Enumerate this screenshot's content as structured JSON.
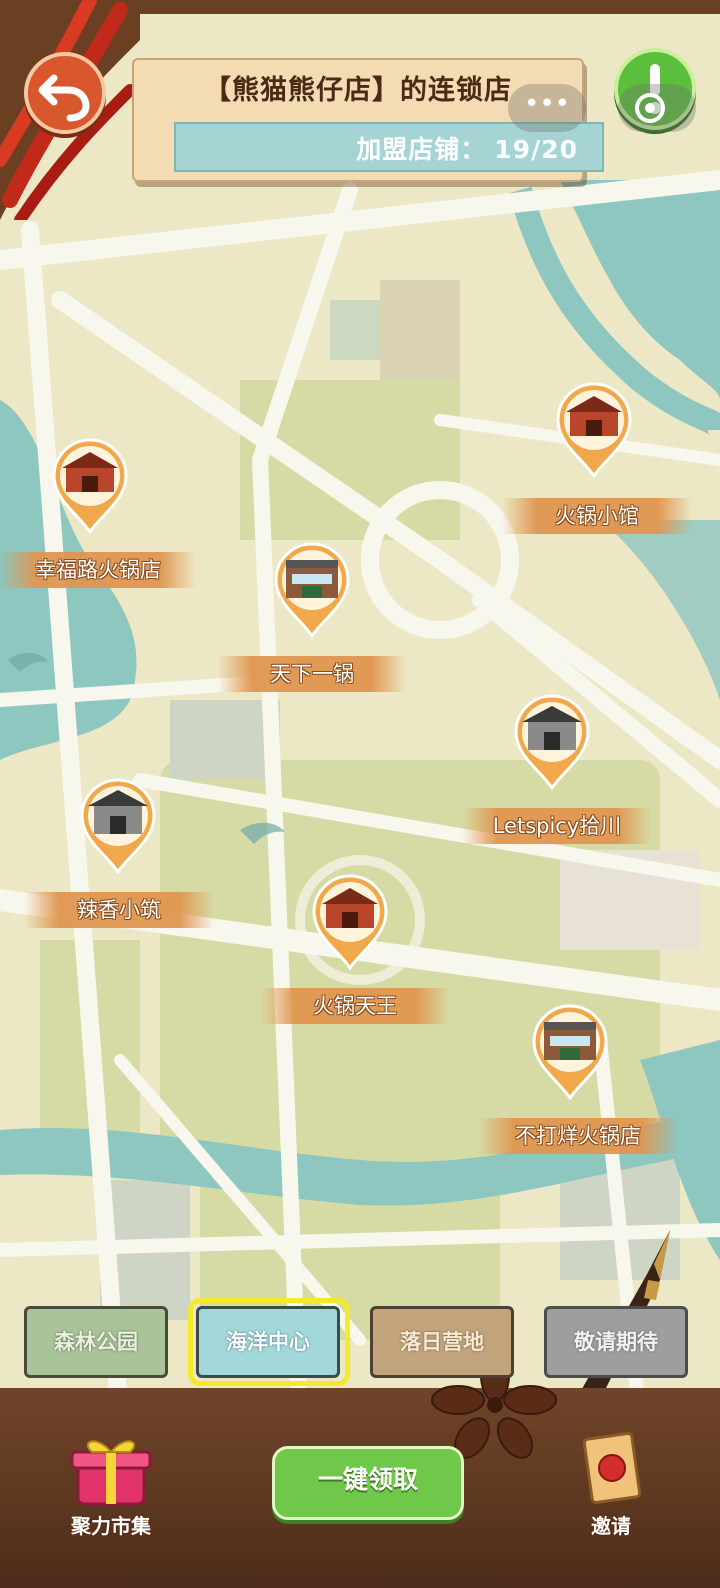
{
  "header": {
    "title": "【熊猫熊仔店】的连锁店",
    "franchise_label": "加盟店铺：",
    "franchise_count": "19/20",
    "menu_dots": "•••"
  },
  "stores": [
    {
      "name": "幸福路火锅店",
      "building": "red-pagoda"
    },
    {
      "name": "天下一锅",
      "building": "shop-front"
    },
    {
      "name": "火锅小馆",
      "building": "red-pagoda"
    },
    {
      "name": "Letspicy拾川",
      "building": "grey-temple"
    },
    {
      "name": "辣香小筑",
      "building": "grey-temple"
    },
    {
      "name": "火锅天王",
      "building": "red-pagoda"
    },
    {
      "name": "不打烊火锅店",
      "building": "shop-front"
    }
  ],
  "tabs": [
    {
      "label": "森林公园"
    },
    {
      "label": "海洋中心",
      "selected": true
    },
    {
      "label": "落日营地"
    },
    {
      "label": "敬请期待"
    }
  ],
  "bottom": {
    "market_label": "聚力市集",
    "claim_button": "一键领取",
    "invite_label": "邀请"
  },
  "colors": {
    "map_land": "#ece7c4",
    "map_park": "#d6dba5",
    "map_water": "#8ec6c0",
    "road": "#f8f7ee",
    "pin_orange": "#f0a84a",
    "claim_green": "#6fc84a",
    "back_red": "#d9572d"
  }
}
